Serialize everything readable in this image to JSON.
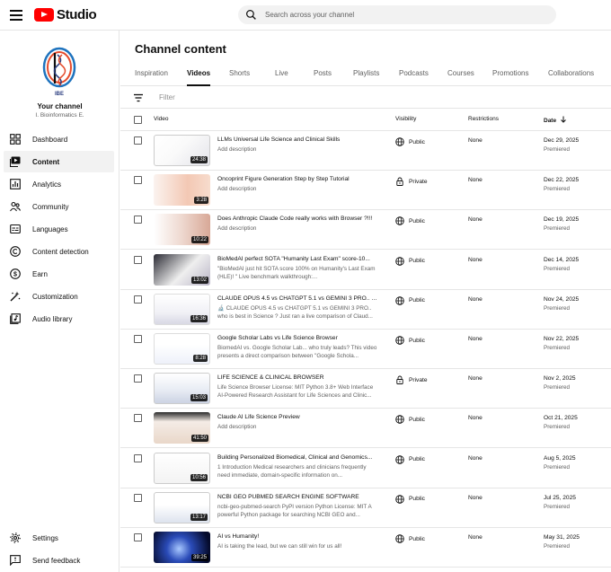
{
  "app": {
    "name": "Studio",
    "search_placeholder": "Search across your channel"
  },
  "channel": {
    "name": "Your channel",
    "handle": "I. Bioinformatics E.",
    "logo_text": "IBE"
  },
  "sidebar": {
    "items": [
      {
        "label": "Dashboard",
        "icon": "dashboard-icon"
      },
      {
        "label": "Content",
        "icon": "content-icon",
        "active": true
      },
      {
        "label": "Analytics",
        "icon": "analytics-icon"
      },
      {
        "label": "Community",
        "icon": "community-icon"
      },
      {
        "label": "Languages",
        "icon": "languages-icon"
      },
      {
        "label": "Content detection",
        "icon": "copyright-icon"
      },
      {
        "label": "Earn",
        "icon": "earn-icon"
      },
      {
        "label": "Customization",
        "icon": "customization-icon"
      },
      {
        "label": "Audio library",
        "icon": "audio-library-icon"
      }
    ],
    "bottom": [
      {
        "label": "Settings",
        "icon": "gear-icon"
      },
      {
        "label": "Send feedback",
        "icon": "feedback-icon"
      }
    ]
  },
  "page": {
    "title": "Channel content",
    "filter_label": "Filter"
  },
  "tabs": [
    "Inspiration",
    "Videos",
    "Shorts",
    "Live",
    "Posts",
    "Playlists",
    "Podcasts",
    "Courses",
    "Promotions",
    "Collaborations"
  ],
  "active_tab": "Videos",
  "table": {
    "headers": {
      "video": "Video",
      "visibility": "Visibility",
      "restrictions": "Restrictions",
      "date": "Date"
    },
    "rows": [
      {
        "title": "LLMs Universal Life Science and Clinical Skills",
        "desc": "Add description",
        "duration": "24:38",
        "visibility": "Public",
        "restrictions": "None",
        "date": "Dec 29, 2025",
        "status": "Premiered"
      },
      {
        "title": "Oncoprint Figure Generation Step by Step Tutorial",
        "desc": "Add description",
        "duration": "3:28",
        "visibility": "Private",
        "restrictions": "None",
        "date": "Dec 22, 2025",
        "status": "Premiered"
      },
      {
        "title": "Does Anthropic Claude Code really works with Browser ?!!!",
        "desc": "Add description",
        "duration": "10:22",
        "visibility": "Public",
        "restrictions": "None",
        "date": "Dec 19, 2025",
        "status": "Premiered"
      },
      {
        "title": "BioMedAI perfect SOTA \"Humanity Last Exam\" score-10...",
        "desc": "\"BioMedAI just hit SOTA score 100% on Humanity's Last Exam (HLE)! \" Live benchmark walkthrough:...",
        "duration": "13:02",
        "visibility": "Public",
        "restrictions": "None",
        "date": "Dec 14, 2025",
        "status": "Premiered"
      },
      {
        "title": "CLAUDE OPUS 4.5 vs CHATGPT 5.1 vs GEMINI 3 PRO.. w...",
        "desc": "🔬 CLAUDE OPUS 4.5 vs CHATGPT 5.1 vs GEMINI 3 PRO.. who is best in Science ? Just ran a live comparison of Claud...",
        "duration": "16:36",
        "visibility": "Public",
        "restrictions": "None",
        "date": "Nov 24, 2025",
        "status": "Premiered"
      },
      {
        "title": "Google Scholar Labs vs Life Science Browser",
        "desc": "BiomedAI vs. Google Scholar Lab... who truly leads? This video presents a direct comparison between \"Google Schola...",
        "duration": "8:28",
        "visibility": "Public",
        "restrictions": "None",
        "date": "Nov 22, 2025",
        "status": "Premiered"
      },
      {
        "title": "LIFE SCIENCE & CLINICAL BROWSER",
        "desc": "Life Science Browser License: MIT Python 3.8+ Web Interface AI-Powered Research Assistant for Life Sciences and Clinic...",
        "duration": "15:03",
        "visibility": "Private",
        "restrictions": "None",
        "date": "Nov 2, 2025",
        "status": "Premiered"
      },
      {
        "title": "Claude AI Life Science Preview",
        "desc": "Add description",
        "duration": "41:50",
        "visibility": "Public",
        "restrictions": "None",
        "date": "Oct 21, 2025",
        "status": "Premiered"
      },
      {
        "title": "Building Personalized Biomedical, Clinical and Genomics...",
        "desc": "1 Introduction Medical researchers and clinicians frequently need immediate, domain-specific information on...",
        "duration": "10:56",
        "visibility": "Public",
        "restrictions": "None",
        "date": "Aug 5, 2025",
        "status": "Premiered"
      },
      {
        "title": "NCBI GEO PUBMED SEARCH ENGINE SOFTWARE",
        "desc": "ncbi-geo-pubmed-search PyPI version Python License: MIT A powerful Python package for searching NCBI GEO and...",
        "duration": "13:17",
        "visibility": "Public",
        "restrictions": "None",
        "date": "Jul 25, 2025",
        "status": "Premiered"
      },
      {
        "title": "AI vs Humanity!",
        "desc": "AI is taking the lead, but we can still win for us all!",
        "duration": "39:25",
        "visibility": "Public",
        "restrictions": "None",
        "date": "May 31, 2025",
        "status": "Premiered"
      }
    ]
  },
  "colors": {
    "brand_red": "#ff0000",
    "text": "#0f0f0f",
    "muted": "#606060",
    "divider": "#e5e5e5"
  }
}
